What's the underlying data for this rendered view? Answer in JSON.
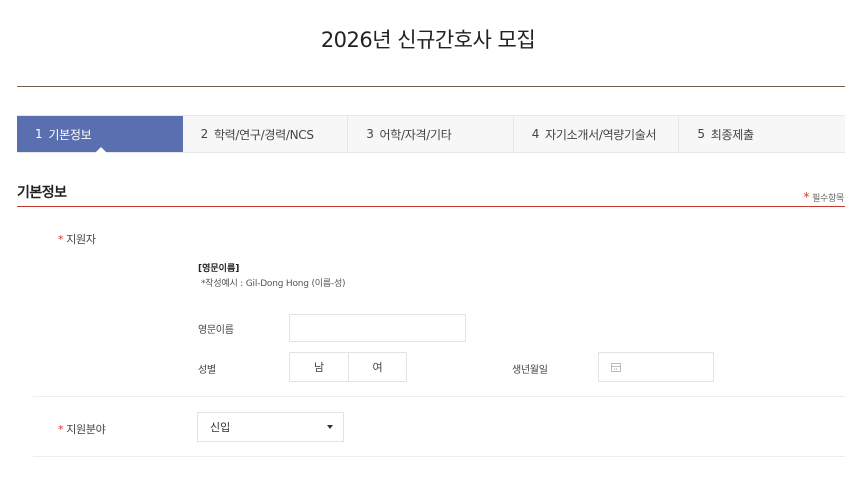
{
  "page": {
    "title": "2026년 신규간호사 모집"
  },
  "steps": [
    {
      "num": "1",
      "label": "기본정보",
      "active": true
    },
    {
      "num": "2",
      "label": "학력/연구/경력/NCS",
      "active": false
    },
    {
      "num": "3",
      "label": "어학/자격/기타",
      "active": false
    },
    {
      "num": "4",
      "label": "자기소개서/역량기술서",
      "active": false
    },
    {
      "num": "5",
      "label": "최종제출",
      "active": false
    }
  ],
  "section": {
    "title": "기본정보",
    "required_note": "필수항목",
    "required_mark": "*"
  },
  "applicant": {
    "label": "지원자",
    "english_name_heading": "[영문이름]",
    "english_name_example": "*작성예시 : Gil-Dong Hong (이름-성)",
    "english_name_label": "영문이름",
    "english_name_value": "",
    "gender_label": "성별",
    "gender_male": "남",
    "gender_female": "여",
    "birth_label": "생년월일",
    "birth_value": ""
  },
  "field": {
    "label": "지원분야",
    "selected": "신입"
  },
  "colors": {
    "accent": "#5a6fb0",
    "required": "#d9342b",
    "rule": "#c0392b"
  }
}
